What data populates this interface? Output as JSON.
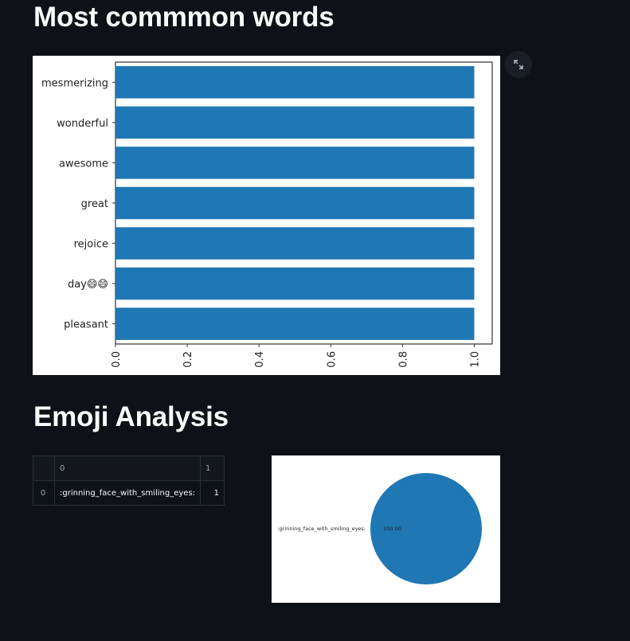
{
  "headings": {
    "common_words": "Most commmon words",
    "emoji": "Emoji Analysis"
  },
  "colors": {
    "background": "#0e1117",
    "bar": "#1f77b4",
    "pie": "#1f77b4"
  },
  "icons": {
    "expand": "expand-icon"
  },
  "emoji_table": {
    "columns": [
      "0",
      "1"
    ],
    "rows": [
      {
        "index": "0",
        "c0": ":grinning_face_with_smiling_eyes:",
        "c1": "1"
      }
    ]
  },
  "chart_data": [
    {
      "type": "bar",
      "orientation": "horizontal",
      "categories": [
        "mesmerizing",
        "wonderful",
        "awesome",
        "great",
        "rejoice",
        "day😄😄",
        "pleasant"
      ],
      "values": [
        1,
        1,
        1,
        1,
        1,
        1,
        1
      ],
      "xlim": [
        0,
        1.05
      ],
      "xticks": [
        "0.0",
        "0.2",
        "0.4",
        "0.6",
        "0.8",
        "1.0"
      ],
      "xtick_values": [
        0,
        0.2,
        0.4,
        0.6,
        0.8,
        1.0
      ],
      "xtick_rotation": "vertical",
      "grid": false,
      "legend": "none"
    },
    {
      "type": "pie",
      "labels": [
        ":grinning_face_with_smiling_eyes:"
      ],
      "values": [
        100
      ],
      "autopct": [
        "100.00"
      ]
    }
  ]
}
